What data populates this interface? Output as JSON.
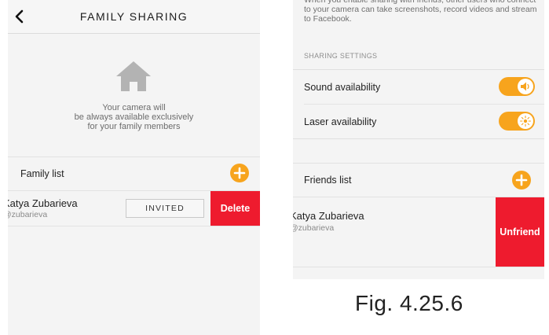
{
  "left_screen": {
    "header": {
      "title": "FAMILY SHARING"
    },
    "info": {
      "lines": [
        "Your camera will",
        "be always available exclusively",
        "for your family members"
      ]
    },
    "family_list": {
      "label": "Family list"
    },
    "member": {
      "name": "Katya Zubarieva",
      "handle": "@zubarieva",
      "status_button": "INVITED",
      "delete_label": "Delete"
    }
  },
  "right_screen": {
    "top_note": "When you enable sharing with friends, other users who connect to your camera can take screenshots, record videos and stream to Facebook.",
    "sharing_settings": {
      "header": "SHARING SETTINGS",
      "items": [
        {
          "label": "Sound availability",
          "enabled": true,
          "icon": "speaker-icon"
        },
        {
          "label": "Laser availability",
          "enabled": true,
          "icon": "laser-icon"
        }
      ]
    },
    "friends_list": {
      "label": "Friends list"
    },
    "friend": {
      "name": "Katya Zubarieva",
      "handle": "@zubarieva",
      "unfriend_label": "Unfriend"
    }
  },
  "caption": "Fig. 4.25.6",
  "colors": {
    "accent": "#f7a41d",
    "destructive": "#ee1b2e",
    "background": "#f4f4f4",
    "icon_gray": "#b3b3b3"
  }
}
